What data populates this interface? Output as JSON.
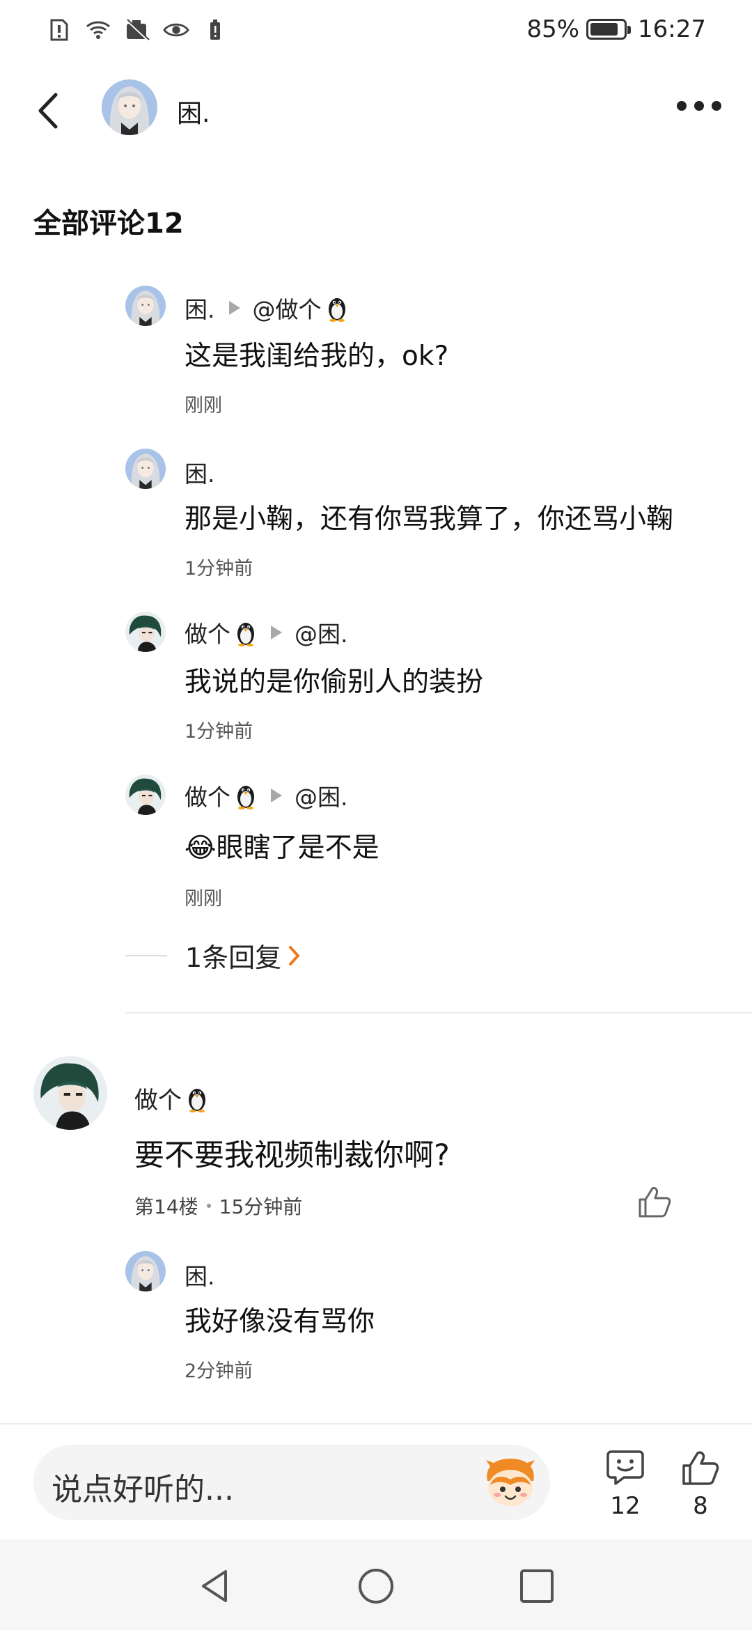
{
  "status_bar": {
    "battery_level": 0.85,
    "battery_text": "85%",
    "time": "16:27"
  },
  "header": {
    "username": "困."
  },
  "section_title": "全部评论12",
  "replies": [
    {
      "name": "困.",
      "reply_to": "@做个",
      "reply_to_has_penguin": true,
      "text": "这是我闺给我的，ok?",
      "time": "刚刚"
    },
    {
      "name": "困.",
      "text": "那是小鞠，还有你骂我算了，你还骂小鞠",
      "time": "1分钟前"
    },
    {
      "name": "做个",
      "name_has_penguin": true,
      "reply_to": "@困.",
      "text": "我说的是你偷别人的装扮",
      "time": "1分钟前"
    },
    {
      "name": "做个",
      "name_has_penguin": true,
      "reply_to": "@困.",
      "text": "眼瞎了是不是",
      "emoji": "😂",
      "time": "刚刚"
    }
  ],
  "more_replies_text": "1条回复",
  "main_comment": {
    "name": "做个",
    "text": "要不要我视频制裁你啊?",
    "floor": "第14楼",
    "time": "15分钟前",
    "reply": {
      "name": "困.",
      "text": "我好像没有骂你",
      "time": "2分钟前"
    }
  },
  "bottom_bar": {
    "input_placeholder": "说点好听的...",
    "comment_count": "12",
    "like_count": "8"
  },
  "colors": {
    "accent_orange": "#f07a1a",
    "text_primary": "#111111",
    "text_secondary": "#555555",
    "divider": "#ececec"
  }
}
